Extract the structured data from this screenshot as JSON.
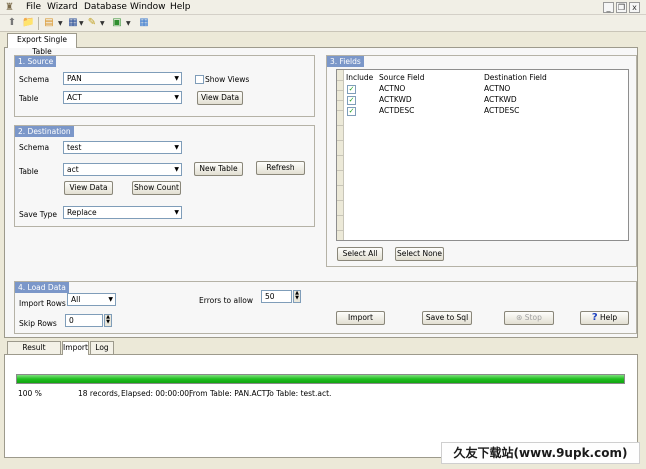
{
  "menubar": {
    "app_icon": "app-icon",
    "menus": [
      "File",
      "Wizard",
      "Database",
      "Window",
      "Help"
    ],
    "window_controls": {
      "minimize": "_",
      "restore": "❐",
      "close": "x"
    }
  },
  "toolbar": {
    "icons": [
      "up-arrow-icon",
      "open-project-icon",
      "export-wizard-icon",
      "query-icon",
      "tools-icon",
      "database-icon",
      "grid-icon"
    ]
  },
  "tabs": {
    "export_single_table": "Export Single Table"
  },
  "source": {
    "title": "1. Source",
    "schema_label": "Schema",
    "schema_value": "PAN",
    "table_label": "Table",
    "table_value": "ACT",
    "show_views_label": "Show Views",
    "show_views_checked": false,
    "view_data_label": "View Data"
  },
  "destination": {
    "title": "2. Destination",
    "schema_label": "Schema",
    "schema_value": "test",
    "table_label": "Table",
    "table_value": "act",
    "new_table_label": "New Table",
    "refresh_label": "Refresh",
    "view_data_label": "View Data",
    "show_count_label": "Show Count",
    "save_type_label": "Save Type",
    "save_type_value": "Replace"
  },
  "fields": {
    "title": "3. Fields",
    "columns": [
      "Include",
      "Source Field",
      "Destination Field"
    ],
    "rows": [
      {
        "include": true,
        "source": "ACTNO",
        "destination": "ACTNO"
      },
      {
        "include": true,
        "source": "ACTKWD",
        "destination": "ACTKWD"
      },
      {
        "include": true,
        "source": "ACTDESC",
        "destination": "ACTDESC"
      }
    ],
    "select_all_label": "Select All",
    "select_none_label": "Select None"
  },
  "load_data": {
    "title": "4. Load Data",
    "import_rows_label": "Import Rows",
    "import_rows_value": "All",
    "skip_rows_label": "Skip Rows",
    "skip_rows_value": "0",
    "errors_label": "Errors to allow",
    "errors_value": "50",
    "import_label": "Import",
    "save_to_sql_label": "Save to Sql",
    "stop_label": "Stop",
    "help_label": "Help"
  },
  "bottom_tabs": [
    "Result Preview",
    "Import",
    "Log"
  ],
  "import_status": {
    "progress_fraction": 1.0,
    "percent_text": "100 %",
    "records_text": "18 records,",
    "elapsed_text": "Elapsed: 00:00:00,",
    "from_text": "From Table: PAN.ACT,",
    "to_text": "To Table: test.act."
  },
  "watermark": {
    "text": "久友下载站(www.9upk.com)"
  },
  "colors": {
    "group_title_bg": "#7b97c9",
    "progress_green": "#1fbf1f",
    "window_bg": "#ece9d8"
  }
}
